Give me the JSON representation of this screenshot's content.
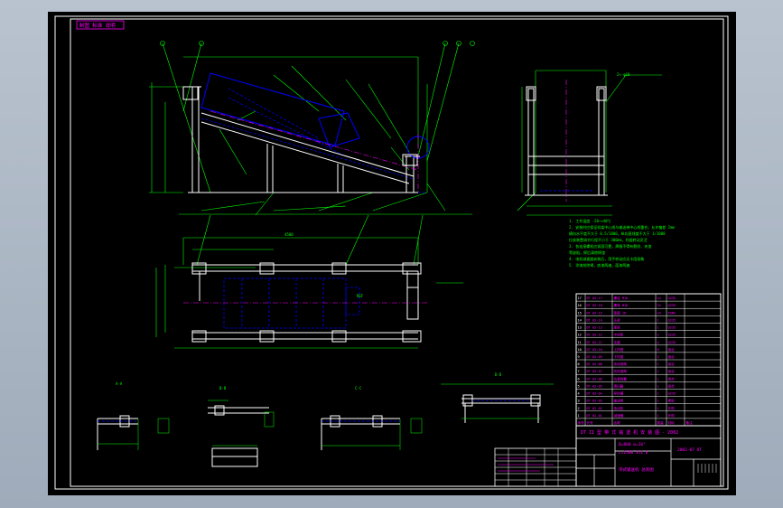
{
  "drawing": {
    "tag": "制图 标准 说明",
    "colors": {
      "background": "#000000",
      "frame": "#ffffff",
      "outline": "#ffffff",
      "dimension": "#00ff00",
      "hidden": "#0000ff",
      "center": "#ff00ff",
      "text": "#00ff00",
      "title_text": "#ff00ff",
      "title_grid": "#ffffff"
    }
  },
  "views": {
    "section_a": "A-A",
    "section_b": "B-B",
    "section_c": "C-C",
    "section_d": "D-D"
  },
  "notes": [
    "1. 工作温度 -20~+40℃",
    "2. 安装时应保证机架中心线与输送带中心线重合，允许偏差 2mm",
    "   横向水平度不大于 0.5/1000，纵向直线度不大于 1/1000",
    "   拉紧装置调节行程不小于 300mm，托辊转动灵活",
    "3. 各连接螺栓应紧固可靠，焊缝不得有裂纹、夹渣",
    "   等缺陷，焊后清除焊渣",
    "4. 电机减速器安装后，用手转动应无卡阻现象",
    "5. 涂漆前除锈，底漆两遍，面漆两遍"
  ],
  "title_block": {
    "project": "DT II 型 带 式 输 送 机 安 装 图 - 2002",
    "spec_line1": "B=800  α=16°",
    "spec_line2": "L=1500  V=1.6",
    "drawing_no": "2002-07 DT",
    "title_name": "带式输送机 总装图",
    "header": [
      "序号",
      "代号",
      "名称",
      "数量",
      "材料",
      "备注"
    ]
  },
  "bom_rows": [
    [
      "17",
      "DT 02-17",
      "螺栓 M16",
      "24",
      "Q235",
      ""
    ],
    [
      "16",
      "DT 02-16",
      "螺母 M16",
      "24",
      "Q235",
      ""
    ],
    [
      "15",
      "DT 02-15",
      "垫圈 16",
      "24",
      "65Mn",
      ""
    ],
    [
      "14",
      "DT 02-14",
      "头架",
      "1",
      "Q235",
      ""
    ],
    [
      "13",
      "DT 02-13",
      "尾架",
      "1",
      "Q235",
      ""
    ],
    [
      "12",
      "DT 02-12",
      "中间架",
      "2",
      "Q235",
      ""
    ],
    [
      "11",
      "DT 02-11",
      "支腿",
      "4",
      "Q235",
      ""
    ],
    [
      "10",
      "DT 02-10",
      "上托辊",
      "8",
      "组合",
      ""
    ],
    [
      "9",
      "DT 02-09",
      "下托辊",
      "3",
      "组合",
      ""
    ],
    [
      "8",
      "DT 02-08",
      "传动滚筒",
      "1",
      "组合",
      ""
    ],
    [
      "7",
      "DT 02-07",
      "改向滚筒",
      "1",
      "组合",
      ""
    ],
    [
      "6",
      "DT 02-06",
      "拉紧装置",
      "1",
      "组合",
      ""
    ],
    [
      "5",
      "DT 02-05",
      "清扫器",
      "1",
      "组合",
      ""
    ],
    [
      "4",
      "DT 02-04",
      "导料槽",
      "1",
      "Q235",
      ""
    ],
    [
      "3",
      "DT 02-03",
      "输送带",
      "1",
      "橡胶",
      ""
    ],
    [
      "2",
      "DT 02-02",
      "电动机",
      "1",
      "外购",
      ""
    ],
    [
      "1",
      "DT 02-01",
      "减速器",
      "1",
      "外购",
      ""
    ]
  ]
}
